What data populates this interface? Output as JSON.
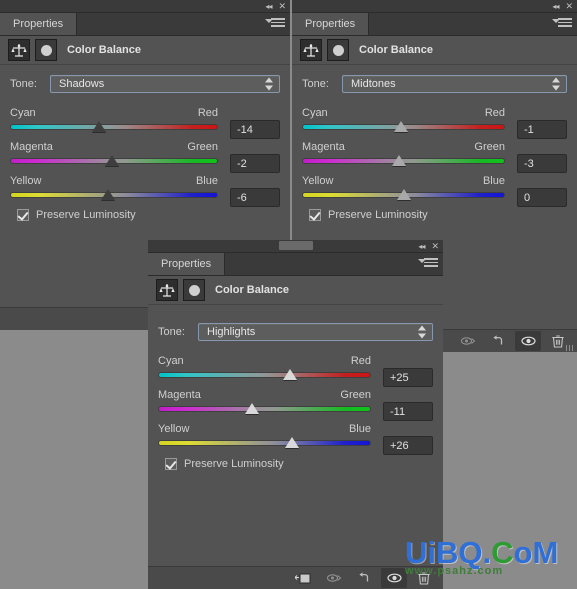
{
  "app": {
    "background_color": "#8b8b8b",
    "panel_bg": "#535353"
  },
  "panels": [
    {
      "id": "shadows",
      "tab_label": "Properties",
      "adjustment_title": "Color Balance",
      "tone_label": "Tone:",
      "tone_value": "Shadows",
      "sliders": [
        {
          "left_label": "Cyan",
          "right_label": "Red",
          "value": "-14",
          "position_pct": 43
        },
        {
          "left_label": "Magenta",
          "right_label": "Green",
          "value": "-2",
          "position_pct": 49
        },
        {
          "left_label": "Yellow",
          "right_label": "Blue",
          "value": "-6",
          "position_pct": 47
        }
      ],
      "preserve_label": "Preserve Luminosity",
      "preserve_checked": true,
      "footer_icons": [
        "clip-to-layer-icon",
        "reset-icon",
        "visibility-eye-icon",
        "delete-trash-icon"
      ]
    },
    {
      "id": "midtones",
      "tab_label": "Properties",
      "adjustment_title": "Color Balance",
      "tone_label": "Tone:",
      "tone_value": "Midtones",
      "sliders": [
        {
          "left_label": "Cyan",
          "right_label": "Red",
          "value": "-1",
          "position_pct": 49
        },
        {
          "left_label": "Magenta",
          "right_label": "Green",
          "value": "-3",
          "position_pct": 48
        },
        {
          "left_label": "Yellow",
          "right_label": "Blue",
          "value": "0",
          "position_pct": 50
        }
      ],
      "preserve_label": "Preserve Luminosity",
      "preserve_checked": true,
      "footer_icons": [
        "clip-to-layer-icon",
        "reset-icon",
        "visibility-eye-icon",
        "delete-trash-icon"
      ]
    },
    {
      "id": "highlights",
      "tab_label": "Properties",
      "adjustment_title": "Color Balance",
      "tone_label": "Tone:",
      "tone_value": "Highlights",
      "sliders": [
        {
          "left_label": "Cyan",
          "right_label": "Red",
          "value": "+25",
          "position_pct": 62
        },
        {
          "left_label": "Magenta",
          "right_label": "Green",
          "value": "-11",
          "position_pct": 44
        },
        {
          "left_label": "Yellow",
          "right_label": "Blue",
          "value": "+26",
          "position_pct": 63
        }
      ],
      "preserve_label": "Preserve Luminosity",
      "preserve_checked": true,
      "footer_icons": [
        "mask-thumbnail-icon",
        "clip-to-layer-icon",
        "reset-icon",
        "visibility-eye-icon",
        "delete-trash-icon"
      ]
    }
  ],
  "window_controls": {
    "collapse_label": "◂◂",
    "close_label": "✕"
  },
  "watermark": {
    "line1_a": "UiBQ.",
    "line1_b": "C",
    "line1_c": "oM",
    "line2": "www.psahz.com",
    "color_blue": "#2f6fd6",
    "color_green": "#2f9b35"
  }
}
